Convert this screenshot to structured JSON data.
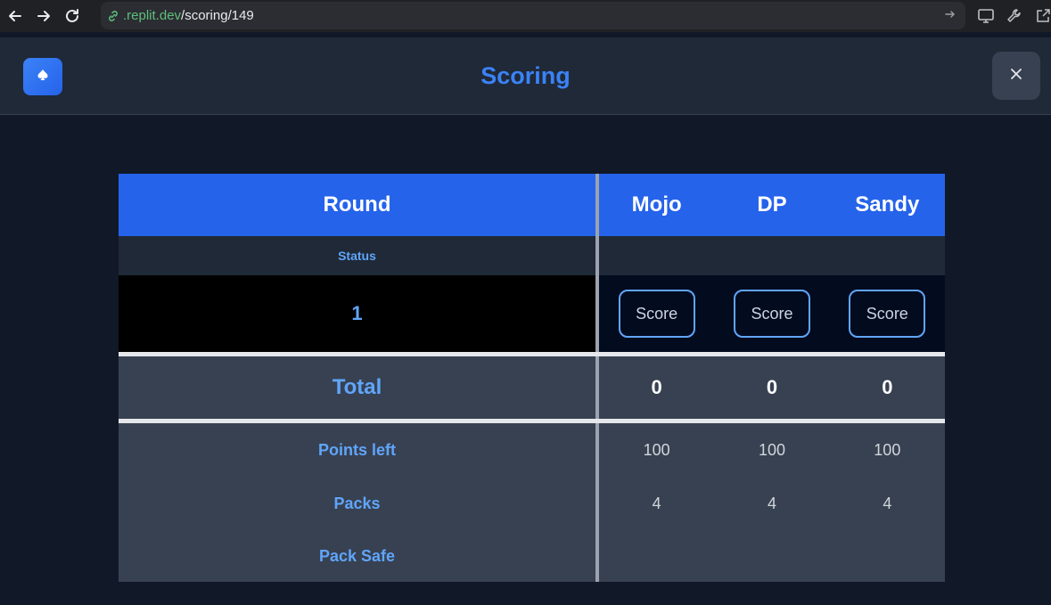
{
  "browser": {
    "url_host": ".replit.dev",
    "url_path": "/scoring/149"
  },
  "header": {
    "title": "Scoring",
    "logo_icon": "spade-icon",
    "close_icon": "close-icon"
  },
  "colors": {
    "accent": "#3b82f6",
    "header_row": "#2563eb",
    "background": "#111827"
  },
  "table": {
    "round_header": "Round",
    "status_label": "Status",
    "players": [
      "Mojo",
      "DP",
      "Sandy"
    ],
    "rounds": [
      {
        "number": "1",
        "buttons": [
          "Score",
          "Score",
          "Score"
        ]
      }
    ],
    "total_label": "Total",
    "totals": [
      "0",
      "0",
      "0"
    ],
    "stats": [
      {
        "label": "Points left",
        "values": [
          "100",
          "100",
          "100"
        ]
      },
      {
        "label": "Packs",
        "values": [
          "4",
          "4",
          "4"
        ]
      },
      {
        "label": "Pack Safe",
        "values": [
          "",
          "",
          ""
        ]
      }
    ]
  }
}
